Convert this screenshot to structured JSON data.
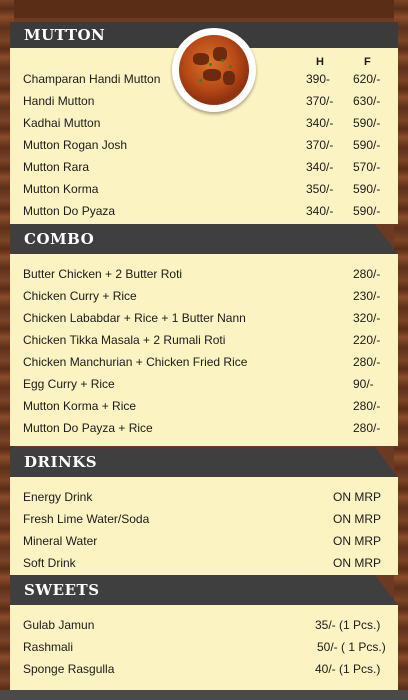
{
  "mutton": {
    "title": "MUTTON",
    "col_h": "H",
    "col_f": "F",
    "items": [
      {
        "name": "Champaran Handi Mutton",
        "h": "390-",
        "f": "620/-"
      },
      {
        "name": "Handi Mutton",
        "h": "370/-",
        "f": "630/-"
      },
      {
        "name": "Kadhai Mutton",
        "h": "340/-",
        "f": "590/-"
      },
      {
        "name": "Mutton Rogan Josh",
        "h": "370/-",
        "f": "590/-"
      },
      {
        "name": "Mutton Rara",
        "h": "340/-",
        "f": "570/-"
      },
      {
        "name": "Mutton Korma",
        "h": "350/-",
        "f": "590/-"
      },
      {
        "name": "Mutton Do Pyaza",
        "h": "340/-",
        "f": "590/-"
      }
    ]
  },
  "combo": {
    "title": "COMBO",
    "items": [
      {
        "name": "Butter Chicken  + 2 Butter Roti",
        "price": "280/-"
      },
      {
        "name": "Chicken Curry + Rice",
        "price": "230/-"
      },
      {
        "name": "Chicken Lababdar + Rice + 1 Butter Nann",
        "price": "320/-"
      },
      {
        "name": "Chicken Tikka Masala + 2 Rumali Roti",
        "price": "220/-"
      },
      {
        "name": "Chicken Manchurian + Chicken Fried Rice",
        "price": "280/-"
      },
      {
        "name": "Egg Curry + Rice",
        "price": "90/-"
      },
      {
        "name": "Mutton Korma + Rice",
        "price": "280/-"
      },
      {
        "name": "Mutton Do Payza + Rice",
        "price": "280/-"
      }
    ]
  },
  "drinks": {
    "title": "DRINKS",
    "items": [
      {
        "name": "Energy Drink",
        "price": "ON MRP"
      },
      {
        "name": "Fresh Lime Water/Soda",
        "price": "ON MRP"
      },
      {
        "name": "Mineral Water",
        "price": "ON MRP"
      },
      {
        "name": "Soft Drink",
        "price": "ON MRP"
      }
    ]
  },
  "sweets": {
    "title": "SWEETS",
    "items": [
      {
        "name": "Gulab Jamun",
        "price": "35/- (1 Pcs.)"
      },
      {
        "name": "Rashmali",
        "price": "50/- ( 1 Pcs.)"
      },
      {
        "name": "Sponge Rasgulla",
        "price": "40/- (1 Pcs.)"
      }
    ]
  },
  "colors": {
    "banner": "#3f3f3f",
    "panel": "#fcf3c2",
    "wood": "#6b3a22"
  },
  "image": {
    "icon": "mutton-curry-dish-image"
  }
}
